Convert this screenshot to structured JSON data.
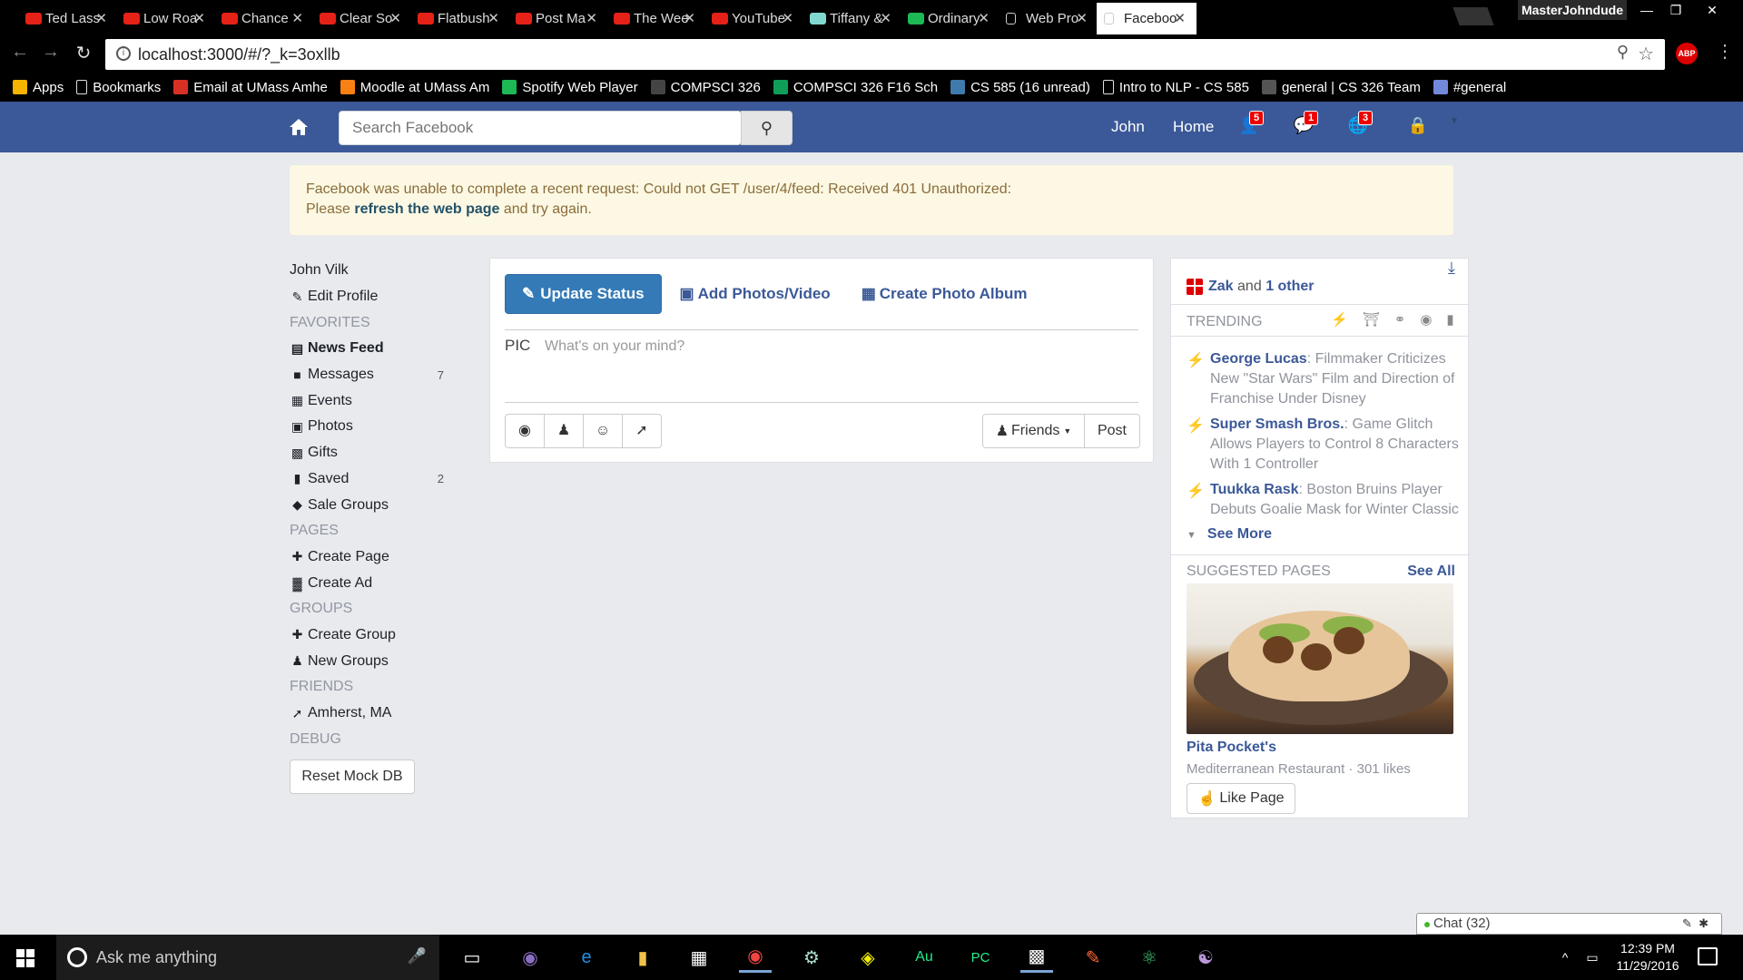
{
  "browser": {
    "tabs": [
      {
        "title": "Ted Lass",
        "icon": "youtube-icon",
        "color": "#e62117"
      },
      {
        "title": "Low Roa",
        "icon": "youtube-icon",
        "color": "#e62117"
      },
      {
        "title": "Chance",
        "icon": "youtube-icon",
        "color": "#e62117"
      },
      {
        "title": "Clear So",
        "icon": "youtube-icon",
        "color": "#e62117"
      },
      {
        "title": "Flatbush",
        "icon": "youtube-icon",
        "color": "#e62117"
      },
      {
        "title": "Post Ma",
        "icon": "youtube-icon",
        "color": "#e62117"
      },
      {
        "title": "The Wee",
        "icon": "youtube-icon",
        "color": "#e62117"
      },
      {
        "title": "YouTube",
        "icon": "youtube-icon",
        "color": "#e62117"
      },
      {
        "title": "Tiffany &",
        "icon": "tiffany-icon",
        "color": "#81d8d0"
      },
      {
        "title": "Ordinary",
        "icon": "spotify-icon",
        "color": "#1db954"
      },
      {
        "title": "Web Pro",
        "icon": "document-icon",
        "color": "#ffffff"
      },
      {
        "title": "Faceboo",
        "icon": "document-icon",
        "color": "#ffffff"
      }
    ],
    "profile_name": "MasterJohndude",
    "url": "localhost:3000/#/?_k=3oxllb",
    "extension_label": "ABP",
    "bookmarks": [
      {
        "label": "Apps",
        "icon": "apps-grid-icon",
        "color": "#f4b400"
      },
      {
        "label": "Bookmarks",
        "icon": "star-icon",
        "color": "#ffffff"
      },
      {
        "label": "Email at UMass Amhe",
        "icon": "gmail-icon",
        "color": "#d93025"
      },
      {
        "label": "Moodle at UMass Am",
        "icon": "moodle-icon",
        "color": "#f98012"
      },
      {
        "label": "Spotify Web Player",
        "icon": "spotify-icon",
        "color": "#1db954"
      },
      {
        "label": "COMPSCI 326",
        "icon": "piazza-icon",
        "color": "#444444"
      },
      {
        "label": "COMPSCI 326 F16 Sch",
        "icon": "sheets-icon",
        "color": "#0f9d58"
      },
      {
        "label": "CS 585 (16 unread)",
        "icon": "piazza-p-icon",
        "color": "#3e7aab"
      },
      {
        "label": "Intro to NLP - CS 585",
        "icon": "document-icon",
        "color": "#ffffff"
      },
      {
        "label": "general | CS 326 Team",
        "icon": "slack-icon",
        "color": "#555555"
      },
      {
        "label": "#general",
        "icon": "discord-icon",
        "color": "#7289da"
      }
    ]
  },
  "fb_header": {
    "search_placeholder": "Search Facebook",
    "user_link": "John",
    "home_link": "Home",
    "friend_requests_count": "5",
    "messages_count": "1",
    "notifications_count": "3",
    "brand_color": "#3b5998"
  },
  "alert": {
    "text_before": "Facebook was unable to complete a recent request: Could not GET /user/4/feed: Received 401 Unauthorized:",
    "text_please": "Please",
    "link_text": "refresh the web page",
    "text_after": "and try again."
  },
  "leftnav": {
    "user_name": "John Vilk",
    "edit_profile": "Edit Profile",
    "favorites_header": "FAVORITES",
    "news_feed": "News Feed",
    "messages": "Messages",
    "messages_count": "7",
    "events": "Events",
    "photos": "Photos",
    "gifts": "Gifts",
    "saved": "Saved",
    "saved_count": "2",
    "sale_groups": "Sale Groups",
    "pages_header": "PAGES",
    "create_page": "Create Page",
    "create_ad": "Create Ad",
    "groups_header": "GROUPS",
    "create_group": "Create Group",
    "new_groups": "New Groups",
    "friends_header": "FRIENDS",
    "location": "Amherst, MA",
    "debug_header": "DEBUG",
    "reset_button": "Reset Mock DB"
  },
  "status": {
    "update_status": "Update Status",
    "add_photos": "Add Photos/Video",
    "create_album": "Create Photo Album",
    "pic_label": "PIC",
    "placeholder": "What's on your mind?",
    "audience": "Friends",
    "post": "Post"
  },
  "right": {
    "bday_name": "Zak",
    "bday_and": "and",
    "bday_other": "1 other",
    "trending_header": "TRENDING",
    "trends": [
      {
        "title": "George Lucas",
        "desc": ": Filmmaker Criticizes New \"Star Wars\" Film and Direction of Franchise Under Disney"
      },
      {
        "title": "Super Smash Bros.",
        "desc": ": Game Glitch Allows Players to Control 8 Characters With 1 Controller"
      },
      {
        "title": "Tuukka Rask",
        "desc": ": Boston Bruins Player Debuts Goalie Mask for Winter Classic"
      }
    ],
    "see_more": "See More",
    "suggested_header": "SUGGESTED PAGES",
    "see_all": "See All",
    "page_name": "Pita Pocket's",
    "page_desc": "Mediterranean Restaurant · 301 likes",
    "like_page": "Like Page"
  },
  "chat": {
    "label": "Chat (32)"
  },
  "taskbar": {
    "search_placeholder": "Ask me anything",
    "time": "12:39 PM",
    "date": "11/29/2016"
  }
}
